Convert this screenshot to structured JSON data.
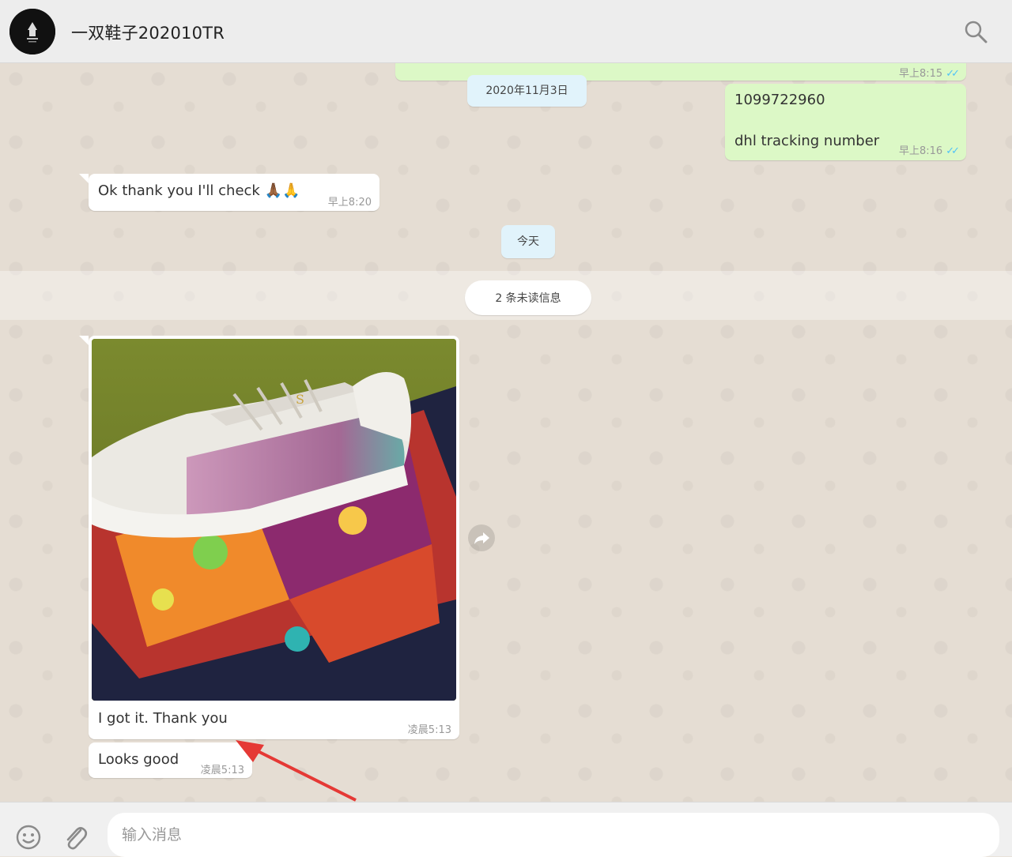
{
  "header": {
    "title": "一双鞋子202010TR"
  },
  "messages": {
    "partial_time": "早上8:15",
    "date_2020": "2020年11月3日",
    "tracking_number": "1099722960",
    "tracking_label": "dhl tracking number",
    "tracking_time": "早上8:16",
    "reply_text": "Ok thank you I'll check 🙏🏾🙏",
    "reply_time": "早上8:20",
    "today": "今天",
    "unread": "2 条未读信息",
    "photo_caption": "I got it. Thank you",
    "photo_time": "凌晨5:13",
    "looks_good": "Looks good",
    "looks_good_time": "凌晨5:13"
  },
  "composer": {
    "placeholder": "输入消息"
  },
  "icons": {
    "search": "search-icon",
    "emoji": "emoji-icon",
    "attach": "paperclip-icon",
    "forward": "forward-icon"
  },
  "colors": {
    "outgoing": "#dcf8c6",
    "incoming": "#ffffff",
    "read_ticks": "#4fc3f7",
    "annotation_arrow": "#e53935"
  }
}
